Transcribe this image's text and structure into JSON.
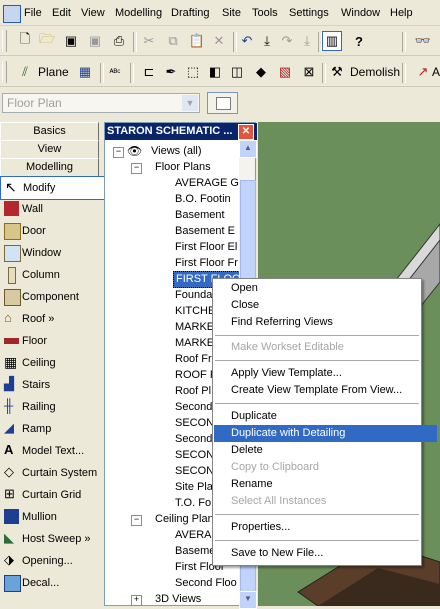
{
  "menu": [
    "File",
    "Edit",
    "View",
    "Modelling",
    "Drafting",
    "Site",
    "Tools",
    "Settings",
    "Window",
    "Help"
  ],
  "toolbar2": {
    "plane_label": "Plane",
    "demolish_label": "Demolish",
    "cut_label": "A"
  },
  "combo": {
    "value": "Floor Plan"
  },
  "tabs": {
    "basics": "Basics",
    "view": "View",
    "modelling": "Modelling"
  },
  "tools": [
    {
      "label": "Modify",
      "icon": "arrow-cursor-icon"
    },
    {
      "label": "Wall",
      "icon": "wall-icon"
    },
    {
      "label": "Door",
      "icon": "door-icon"
    },
    {
      "label": "Window",
      "icon": "window-icon"
    },
    {
      "label": "Column",
      "icon": "column-icon"
    },
    {
      "label": "Component",
      "icon": "component-icon"
    },
    {
      "label": "Roof »",
      "icon": "roof-icon"
    },
    {
      "label": "Floor",
      "icon": "floor-icon"
    },
    {
      "label": "Ceiling",
      "icon": "ceiling-icon"
    },
    {
      "label": "Stairs",
      "icon": "stairs-icon"
    },
    {
      "label": "Railing",
      "icon": "railing-icon"
    },
    {
      "label": "Ramp",
      "icon": "ramp-icon"
    },
    {
      "label": "Model Text...",
      "icon": "model-text-icon"
    },
    {
      "label": "Curtain System",
      "icon": "curtain-system-icon"
    },
    {
      "label": "Curtain Grid",
      "icon": "curtain-grid-icon"
    },
    {
      "label": "Mullion",
      "icon": "mullion-icon"
    },
    {
      "label": "Host Sweep »",
      "icon": "host-sweep-icon"
    },
    {
      "label": "Opening...",
      "icon": "opening-icon"
    },
    {
      "label": "Decal...",
      "icon": "decal-icon"
    }
  ],
  "browser": {
    "title": "STARON SCHEMATIC ...",
    "tree": [
      {
        "label": "Views (all)",
        "kind": "root"
      },
      {
        "label": "Floor Plans",
        "kind": "group"
      },
      {
        "label": "AVERAGE G",
        "kind": "leaf"
      },
      {
        "label": "B.O. Footin",
        "kind": "leaf"
      },
      {
        "label": "Basement",
        "kind": "leaf"
      },
      {
        "label": "Basement E",
        "kind": "leaf"
      },
      {
        "label": "First Floor El",
        "kind": "leaf"
      },
      {
        "label": "First Floor Fr",
        "kind": "leaf"
      },
      {
        "label": "FIRST FLOO",
        "kind": "leaf-selected"
      },
      {
        "label": "Founda",
        "kind": "leaf"
      },
      {
        "label": "KITCHE",
        "kind": "leaf"
      },
      {
        "label": "MARKE",
        "kind": "leaf"
      },
      {
        "label": "MARKE",
        "kind": "leaf"
      },
      {
        "label": "Roof Fr",
        "kind": "leaf"
      },
      {
        "label": "ROOF P",
        "kind": "leaf"
      },
      {
        "label": "Roof Pl",
        "kind": "leaf"
      },
      {
        "label": "Second",
        "kind": "leaf"
      },
      {
        "label": "SECON",
        "kind": "leaf"
      },
      {
        "label": "Second",
        "kind": "leaf"
      },
      {
        "label": "SECON",
        "kind": "leaf"
      },
      {
        "label": "SECON",
        "kind": "leaf"
      },
      {
        "label": "Site Pla",
        "kind": "leaf"
      },
      {
        "label": "T.O. Fo",
        "kind": "leaf"
      },
      {
        "label": "Ceiling Plan",
        "kind": "group"
      },
      {
        "label": "AVERA",
        "kind": "leaf"
      },
      {
        "label": "Baseme",
        "kind": "leaf"
      },
      {
        "label": "First Floor",
        "kind": "leaf"
      },
      {
        "label": "Second Floo",
        "kind": "leaf"
      },
      {
        "label": "3D Views",
        "kind": "group"
      }
    ]
  },
  "context_menu": {
    "items": [
      {
        "label": "Open",
        "state": "normal"
      },
      {
        "label": "Close",
        "state": "normal"
      },
      {
        "label": "Find Referring Views",
        "state": "normal"
      },
      {
        "label": "Make Workset Editable",
        "state": "disabled"
      },
      {
        "label": "Apply View Template...",
        "state": "normal"
      },
      {
        "label": "Create View Template From View...",
        "state": "normal"
      },
      {
        "label": "Duplicate",
        "state": "normal"
      },
      {
        "label": "Duplicate with Detailing",
        "state": "highlighted"
      },
      {
        "label": "Delete",
        "state": "normal"
      },
      {
        "label": "Copy to Clipboard",
        "state": "disabled"
      },
      {
        "label": "Rename",
        "state": "normal"
      },
      {
        "label": "Select All Instances",
        "state": "disabled"
      },
      {
        "label": "Properties...",
        "state": "normal"
      },
      {
        "label": "Save to New File...",
        "state": "normal"
      }
    ]
  },
  "colors": {
    "selection": "#316ac5",
    "title_bar": "#0a246a",
    "viewport": "#6b8f5b",
    "panel": "#ece9d8"
  }
}
